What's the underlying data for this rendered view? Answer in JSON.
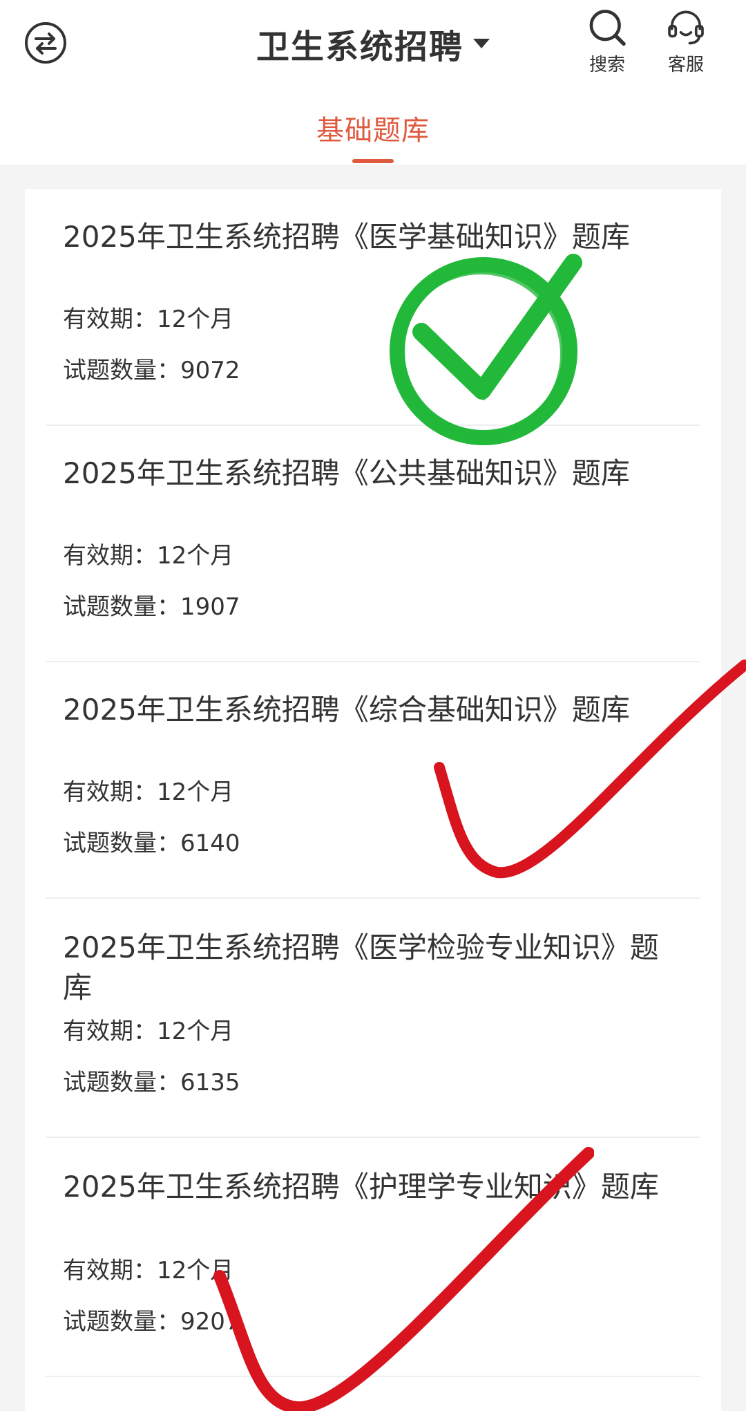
{
  "header": {
    "title": "卫生系统招聘",
    "search_label": "搜索",
    "service_label": "客服"
  },
  "tabs": [
    {
      "label": "基础题库",
      "active": true
    }
  ],
  "colors": {
    "accent": "#e05a3f",
    "check_green": "#22b83a",
    "check_red": "#d8141e"
  },
  "bank_items": [
    {
      "title": "2025年卫生系统招聘《医学基础知识》题库",
      "validity": "有效期：12个月",
      "count": "试题数量：9072"
    },
    {
      "title": "2025年卫生系统招聘《公共基础知识》题库",
      "validity": "有效期：12个月",
      "count": "试题数量：1907"
    },
    {
      "title": "2025年卫生系统招聘《综合基础知识》题库",
      "validity": "有效期：12个月",
      "count": "试题数量：6140"
    },
    {
      "title": "2025年卫生系统招聘《医学检验专业知识》题库",
      "validity": "有效期：12个月",
      "count": "试题数量：6135"
    },
    {
      "title": "2025年卫生系统招聘《护理学专业知识》题库",
      "validity": "有效期：12个月",
      "count": "试题数量：9207"
    }
  ],
  "overlays": {
    "green_check_icon": "check-circle-icon",
    "red_check_icon": "hand-drawn-check-icon"
  }
}
